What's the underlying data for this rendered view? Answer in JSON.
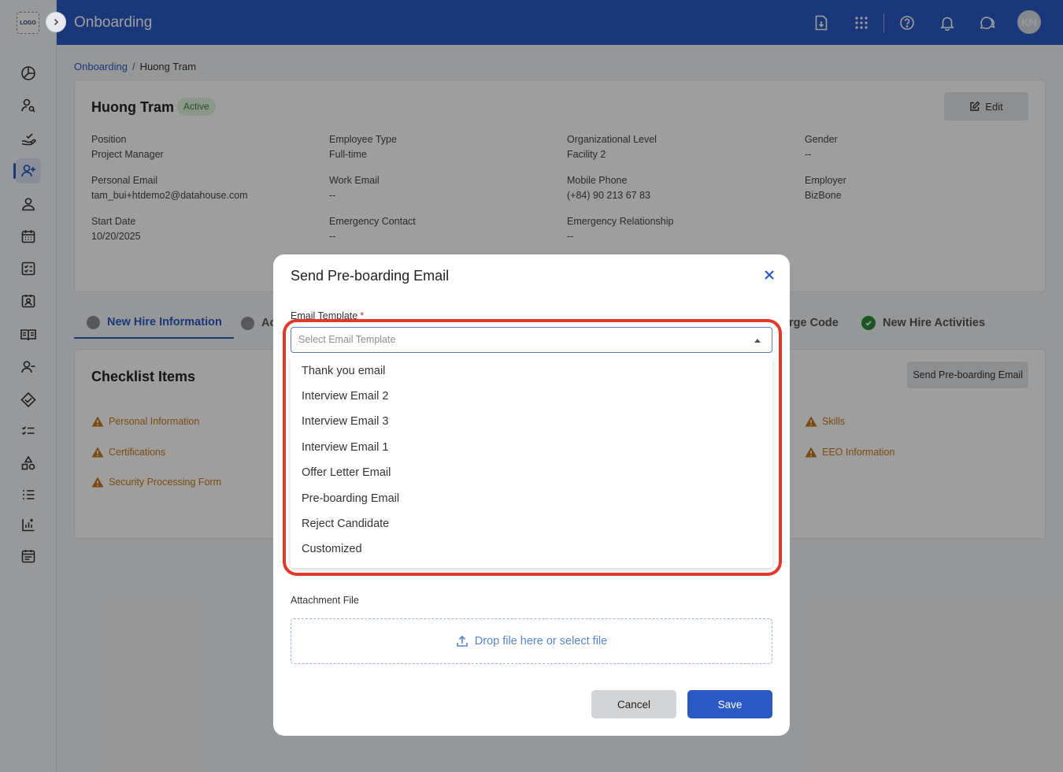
{
  "app": {
    "logo_text": "LOGO",
    "title": "Onboarding",
    "avatar_initials": "KN"
  },
  "sidebar": {
    "icons": [
      "pie-chart-icon",
      "user-search-icon",
      "hand-check-icon",
      "user-plus-icon",
      "user-icon",
      "calendar-icon",
      "checklist-icon",
      "id-card-icon",
      "book-icon",
      "user-minus-icon",
      "handshake-icon",
      "task-list-icon",
      "shapes-icon",
      "ordered-list-icon",
      "chart-icon",
      "schedule-icon"
    ],
    "active_index": 3
  },
  "topbar": {
    "icons": [
      "download-file-icon",
      "apps-grid-icon",
      "help-icon",
      "bell-icon",
      "chat-icon"
    ]
  },
  "breadcrumb": {
    "root": "Onboarding",
    "separator": "/",
    "current": "Huong Tram"
  },
  "employee": {
    "name": "Huong Tram",
    "status": "Active",
    "edit_label": "Edit",
    "fields": [
      {
        "label": "Position",
        "value": "Project Manager"
      },
      {
        "label": "Employee Type",
        "value": "Full-time"
      },
      {
        "label": "Organizational Level",
        "value": "Facility 2"
      },
      {
        "label": "Gender",
        "value": "--"
      },
      {
        "label": "Personal Email",
        "value": "tam_bui+htdemo2@datahouse.com"
      },
      {
        "label": "Work Email",
        "value": "--"
      },
      {
        "label": "Mobile Phone",
        "value": "(+84) 90 213 67 83"
      },
      {
        "label": "Employer",
        "value": "BizBone"
      },
      {
        "label": "Start Date",
        "value": "10/20/2025"
      },
      {
        "label": "Emergency Contact",
        "value": "--"
      },
      {
        "label": "Emergency Relationship",
        "value": "--"
      }
    ]
  },
  "tabs": [
    {
      "label": "New Hire Information"
    },
    {
      "label": "Ac"
    },
    {
      "label": "rge Code"
    },
    {
      "label": "New Hire Activities"
    }
  ],
  "checklist": {
    "title": "Checklist Items",
    "send_button": "Send Pre-boarding Email",
    "items": [
      "Personal Information",
      "Certifications",
      "Security Processing Form",
      "Skills",
      "EEO Information"
    ]
  },
  "modal": {
    "title": "Send Pre-boarding Email",
    "template_label": "Email Template",
    "required_mark": "*",
    "template_placeholder": "Select Email Template",
    "options": [
      "Thank you email",
      "Interview Email 2",
      "Interview Email 3",
      "Interview Email 1",
      "Offer Letter Email",
      "Pre-boarding Email",
      "Reject Candidate",
      "Customized"
    ],
    "attachment_label": "Attachment File",
    "dropzone_text": "Drop file here or select file",
    "cancel_label": "Cancel",
    "save_label": "Save"
  },
  "colors": {
    "primary": "#2b59c3",
    "warning": "#c77a18",
    "highlight": "#e0392c",
    "success": "#2e8b3a"
  }
}
